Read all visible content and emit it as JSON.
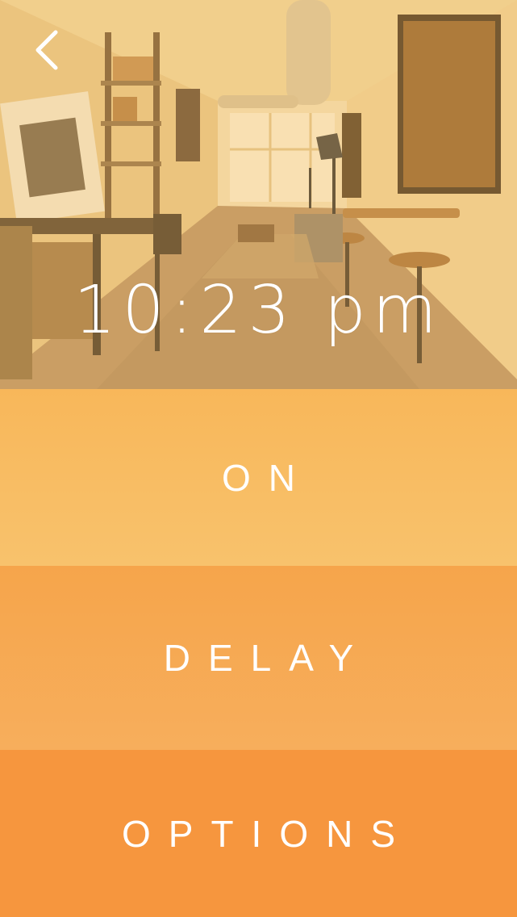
{
  "header": {
    "back_icon": "chevron-left-icon"
  },
  "clock": {
    "time": "10:23 pm"
  },
  "actions": {
    "on_label": "ON",
    "delay_label": "DELAY",
    "options_label": "OPTIONS"
  },
  "colors": {
    "on_band": "#f8bd63",
    "delay_band": "#f6a955",
    "options_band": "#f6963e",
    "text": "#ffffff"
  }
}
